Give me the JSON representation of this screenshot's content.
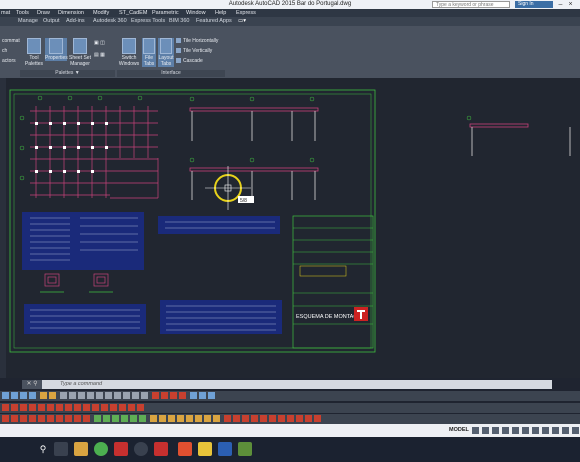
{
  "title_bar": {
    "title": "Autodesk AutoCAD 2015   Bar do Portugal.dwg",
    "search_placeholder": "Type a keyword or phrase",
    "sign_in": "Sign In"
  },
  "menu_bar": {
    "items": [
      "mat",
      "Tools",
      "Draw",
      "Dimension",
      "Modify",
      "ST_CadEM",
      "Parametric",
      "Window",
      "Help",
      "Express"
    ]
  },
  "ribbon_tabs": {
    "items": [
      "Manage",
      "Output",
      "Add-ins",
      "Autodesk 360",
      "Express Tools",
      "BIM 360",
      "Featured Apps"
    ]
  },
  "ribbon": {
    "left_cut": [
      "commat",
      "ch",
      "actors"
    ],
    "palettes": [
      "Tool Palettes",
      "Properties",
      "Sheet Set Manager"
    ],
    "palettes_label": "Palettes ▼",
    "interface": {
      "switch_windows": "Switch Windows",
      "file_tabs": "File Tabs",
      "layout_tabs": "Layout Tabs",
      "tile_horizontally": "Tile Horizontally",
      "tile_vertically": "Tile Vertically",
      "cascade": "Cascade"
    },
    "interface_label": "Interface"
  },
  "drawing": {
    "title_block_text": "ESQUEMA DE MONTAGEM",
    "cursor_tooltip": "5/8"
  },
  "command_line": {
    "placeholder": "Type a command"
  },
  "status_bar": {
    "model": "MODEL"
  },
  "colors": {
    "canvas": "#212630",
    "frame": "#3fbf3f",
    "blueprint": "#1a2a7a",
    "accent": "#c8427a"
  }
}
